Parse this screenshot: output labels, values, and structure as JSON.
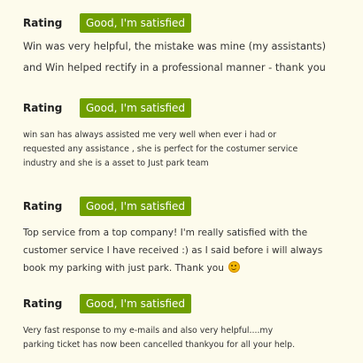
{
  "rating_label": "Rating",
  "badge_color": "#6f9f00",
  "reviews": [
    {
      "rating_text": "Good, I'm satisfied",
      "lines": [
        "Win was very helpful, the mistake was mine (my assistants)",
        "and Win helped rectify in a professional manner - thank you"
      ]
    },
    {
      "rating_text": "Good, I'm satisfied",
      "lines": [
        "win san has always assisted me very well when ever i had or",
        "requested any assistance , she is perfect for the costumer service",
        "industry and she is a asset to Just park team"
      ]
    },
    {
      "rating_text": "Good, I'm satisfied",
      "lines": [
        "Top service from a top company! I'm really satisfied with the",
        "customer service I have received :) as I said before i will always",
        "book my parking with just park. Thank you"
      ],
      "emoji": "smiling-face-icon"
    },
    {
      "rating_text": "Good, I'm satisfied",
      "lines": [
        "Very fast response to my e-mails and also very helpful....my",
        "parking ticket has now been cancelled thankyou for all your help."
      ]
    }
  ]
}
